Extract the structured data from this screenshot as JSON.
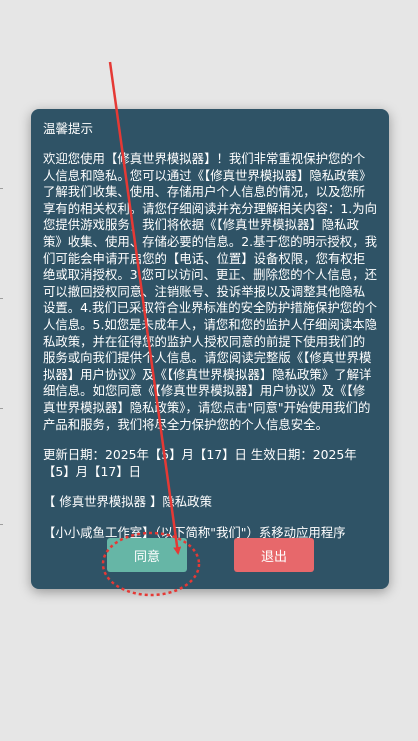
{
  "dialog": {
    "title": "温馨提示",
    "body": "欢迎您使用【修真世界模拟器】！我们非常重视保护您的个人信息和隐私。您可以通过《【修真世界模拟器】隐私政策》了解我们收集、使用、存储用户个人信息的情况，以及您所享有的相关权利。请您仔细阅读并充分理解相关内容：1.为向您提供游戏服务，我们将依据《【修真世界模拟器】隐私政策》收集、使用、存储必要的信息。2.基于您的明示授权，我们可能会申请开启您的【电话、位置】设备权限，您有权拒绝或取消授权。3.您可以访问、更正、删除您的个人信息，还可以撤回授权同意、注销账号、投诉举报以及调整其他隐私设置。4.我们已采取符合业界标准的安全防护措施保护您的个人信息。5.如您是未成年人，请您和您的监护人仔细阅读本隐私政策，并在征得您的监护人授权同意的前提下使用我们的服务或向我们提供个人信息。请您阅读完整版《【修真世界模拟器】用户协议》及《【修真世界模拟器】隐私政策》了解详细信息。如您同意《【修真世界模拟器】用户协议》及《【修真世界模拟器】隐私政策》，请您点击\"同意\"开始使用我们的产品和服务，我们将尽全力保护您的个人信息安全。",
    "dates": "更新日期：2025年【5】月【17】日 生效日期：2025年【5】月【17】日",
    "policy_title": "【 修真世界模拟器 】隐私政策",
    "intro": "【小小咸鱼工作室】（以下简称\"我们\"）系移动应用程序",
    "agree_label": "同意",
    "exit_label": "退出"
  },
  "colors": {
    "dialog_bg": "#2f5366",
    "agree": "#66b6a6",
    "exit": "#e7686b",
    "annotation": "#e53935"
  },
  "annotation": {
    "type": "arrow-and-dotted-circle",
    "target": "agree-button"
  }
}
